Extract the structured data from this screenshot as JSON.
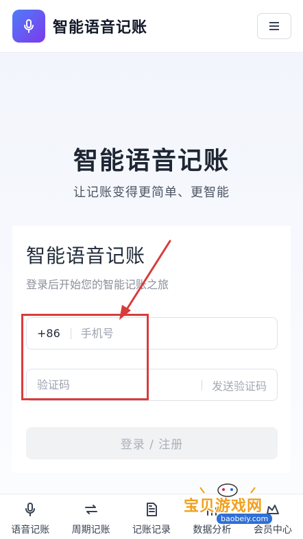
{
  "header": {
    "app_title": "智能语音记账",
    "logo_icon": "microphone-icon",
    "menu_icon": "hamburger-menu-icon"
  },
  "hero": {
    "title": "智能语音记账",
    "subtitle": "让记账变得更简单、更智能"
  },
  "login_card": {
    "title": "智能语音记账",
    "subtitle": "登录后开始您的智能记账之旅",
    "phone": {
      "prefix": "+86",
      "placeholder": "手机号",
      "value": ""
    },
    "code": {
      "placeholder": "验证码",
      "value": "",
      "send_label": "发送验证码"
    },
    "submit_label": "登录 / 注册"
  },
  "bottom_nav": {
    "items": [
      {
        "label": "语音记账",
        "icon": "microphone-icon"
      },
      {
        "label": "周期记账",
        "icon": "repeat-arrows-icon"
      },
      {
        "label": "记账记录",
        "icon": "document-icon"
      },
      {
        "label": "数据分析",
        "icon": "chart-icon"
      },
      {
        "label": "会员中心",
        "icon": "crown-icon"
      }
    ]
  },
  "watermark": {
    "text": "宝贝游戏网",
    "url": "baobeiy.com"
  },
  "colors": {
    "brand_gradient_start": "#4f7cf7",
    "brand_gradient_end": "#7c3aed",
    "annotation_red": "#d93b3b"
  }
}
